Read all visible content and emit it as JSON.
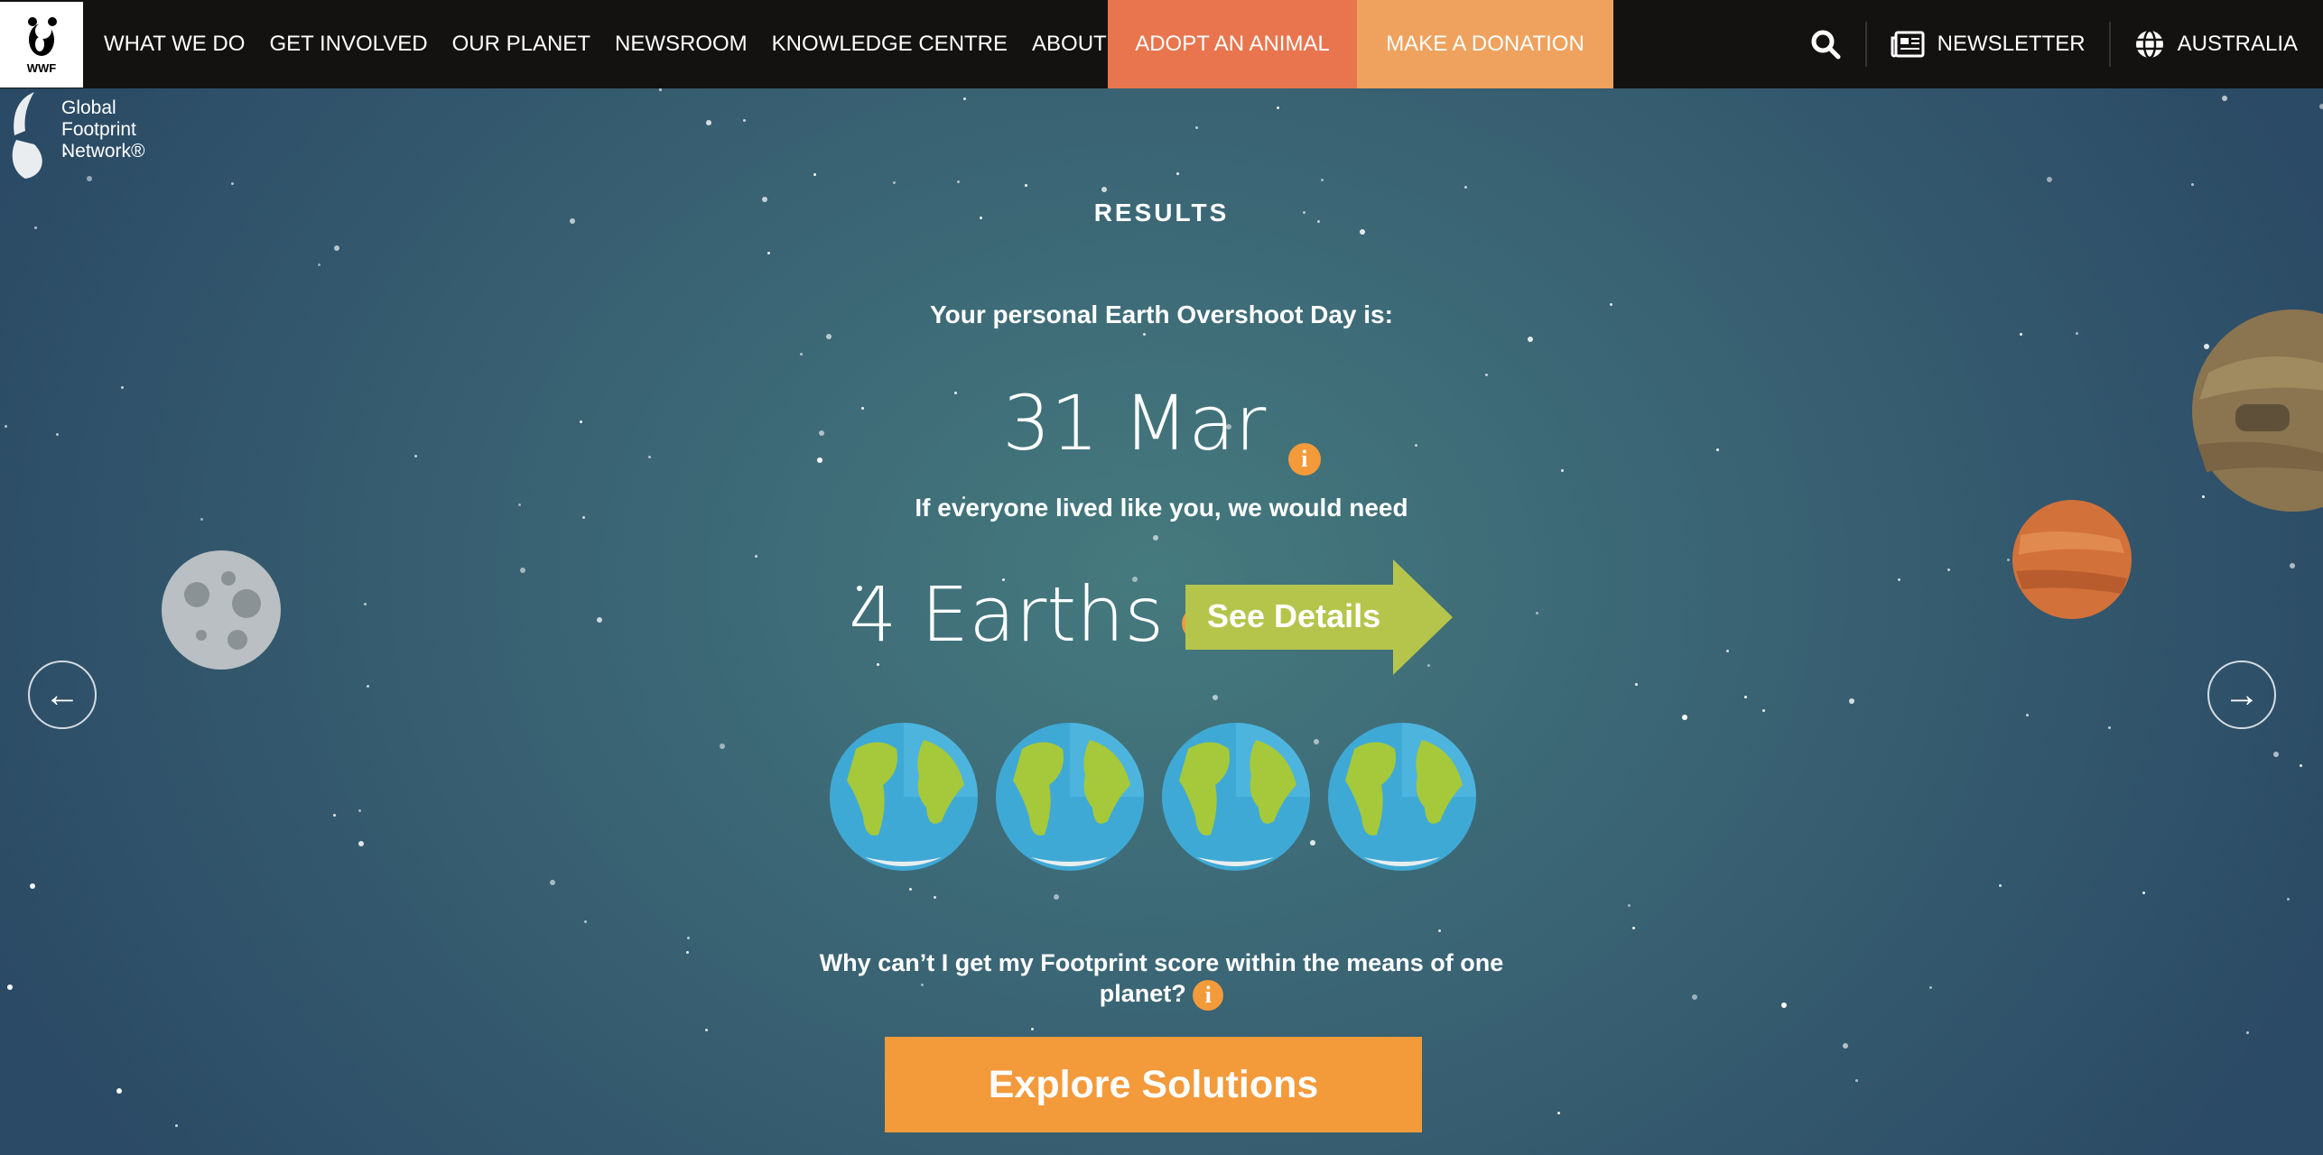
{
  "nav": {
    "logo_text": "WWF",
    "items": [
      "WHAT WE DO",
      "GET INVOLVED",
      "OUR PLANET",
      "NEWSROOM",
      "KNOWLEDGE CENTRE",
      "ABOUT US"
    ],
    "adopt": "ADOPT AN ANIMAL",
    "donate": "MAKE A DONATION",
    "newsletter": "NEWSLETTER",
    "region": "AUSTRALIA"
  },
  "brand": {
    "lines": [
      "Global",
      "Footprint",
      "Network®"
    ]
  },
  "results": {
    "heading": "RESULTS",
    "overshoot_label": "Your personal Earth Overshoot Day is:",
    "overshoot_date": "31 Mar",
    "need_label": "If everyone lived like you, we would need",
    "earths": "4 Earths",
    "earth_count": 4,
    "details_button": "See Details",
    "question": "Why can’t I get my Footprint score within the means of one planet?",
    "explore_button": "Explore Solutions",
    "info_glyph": "i"
  },
  "colors": {
    "adopt": "#e8754d",
    "donate": "#eea25e",
    "details": "#b5c54c",
    "explore": "#f39a3b",
    "info": "#f39a3b",
    "nav_bg": "#141210"
  }
}
